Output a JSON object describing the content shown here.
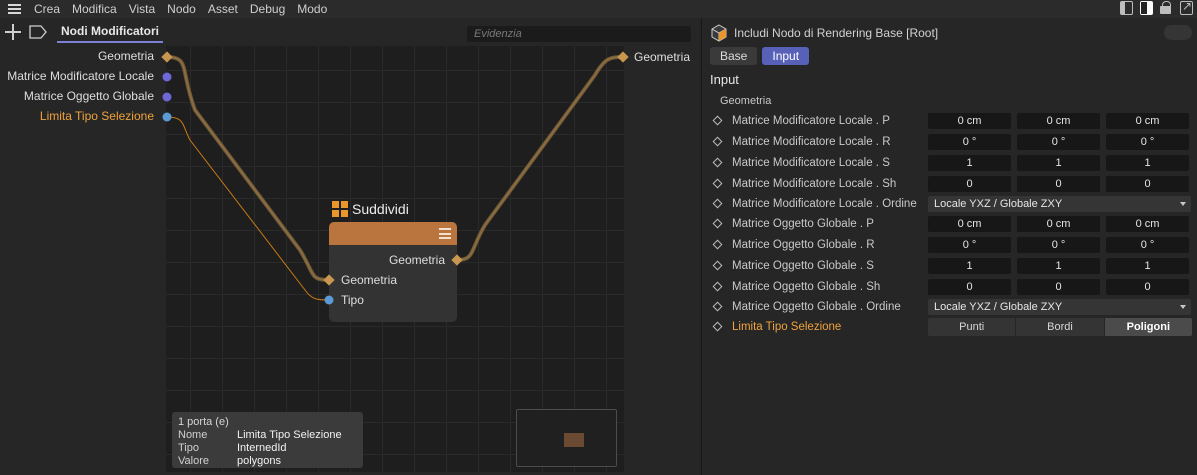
{
  "menu": [
    "Crea",
    "Modifica",
    "Vista",
    "Nodo",
    "Asset",
    "Debug",
    "Modo"
  ],
  "left": {
    "tab_label": "Nodi Modificatori",
    "search_placeholder": "Evidenzia",
    "input_ports": [
      "Geometria",
      "Matrice Modificatore Locale",
      "Matrice Oggetto Globale",
      "Limita Tipo Selezione"
    ],
    "output_port": "Geometria"
  },
  "node": {
    "title": "Suddividi",
    "output_port": "Geometria",
    "input_ports": [
      "Geometria",
      "Tipo"
    ]
  },
  "info": {
    "count": "1 porta (e)",
    "rows": [
      {
        "key": "Nome",
        "value": "Limita Tipo Selezione"
      },
      {
        "key": "Tipo",
        "value": "InternedId"
      },
      {
        "key": "Valore",
        "value": "polygons"
      }
    ]
  },
  "right": {
    "title": "Includi Nodo di Rendering Base [Root]",
    "tabs": [
      "Base",
      "Input"
    ],
    "section": "Input",
    "group": "Geometria",
    "rows": [
      {
        "label": "Matrice Modificatore Locale . P",
        "values": [
          "0 cm",
          "0 cm",
          "0 cm"
        ]
      },
      {
        "label": "Matrice Modificatore Locale . R",
        "values": [
          "0 °",
          "0 °",
          "0 °"
        ]
      },
      {
        "label": "Matrice Modificatore Locale . S",
        "values": [
          "1",
          "1",
          "1"
        ]
      },
      {
        "label": "Matrice Modificatore Locale . Sh",
        "values": [
          "0",
          "0",
          "0"
        ]
      },
      {
        "label": "Matrice Modificatore Locale . Ordine",
        "dropdown": "Locale YXZ / Globale ZXY"
      },
      {
        "label": "Matrice Oggetto Globale . P",
        "values": [
          "0 cm",
          "0 cm",
          "0 cm"
        ]
      },
      {
        "label": "Matrice Oggetto Globale . R",
        "values": [
          "0 °",
          "0 °",
          "0 °"
        ]
      },
      {
        "label": "Matrice Oggetto Globale . S",
        "values": [
          "1",
          "1",
          "1"
        ]
      },
      {
        "label": "Matrice Oggetto Globale . Sh",
        "values": [
          "0",
          "0",
          "0"
        ]
      },
      {
        "label": "Matrice Oggetto Globale . Ordine",
        "dropdown": "Locale YXZ / Globale ZXY"
      },
      {
        "label": "Limita Tipo Selezione",
        "options": [
          "Punti",
          "Bordi",
          "Poligoni"
        ],
        "selected": "Poligoni"
      }
    ]
  },
  "colors": {
    "accent": "#5861b8",
    "geometry_port": "#c8964f",
    "matrix_port": "#6e67d6",
    "id_port": "#5b9bd5",
    "orange_label": "#f0a23c",
    "node_header": "#b9753d"
  }
}
